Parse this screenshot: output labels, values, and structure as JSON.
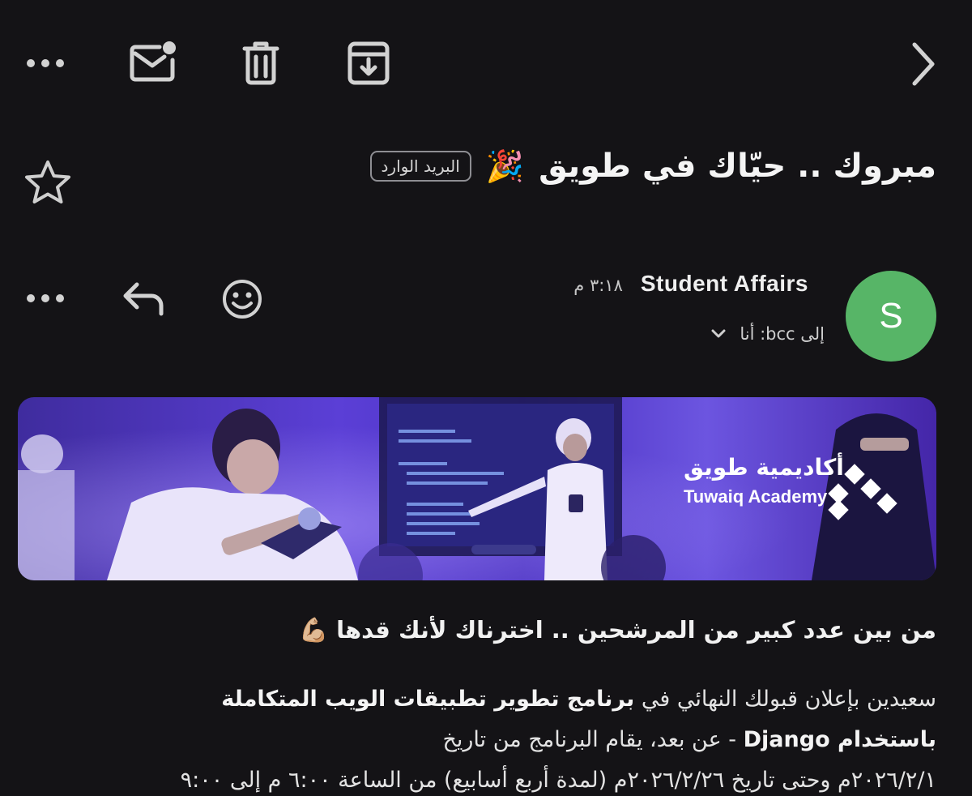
{
  "toolbar": {
    "icons": [
      "more-horizontal-icon",
      "mark-unread-icon",
      "trash-icon",
      "archive-icon",
      "chevron-right-icon"
    ]
  },
  "subject": {
    "text": "مبروك .. حيّاك في طويق",
    "emoji": "🎉",
    "label": "البريد الوارد"
  },
  "message": {
    "avatar_letter": "S",
    "avatar_color": "#57B567",
    "sender": "Student Affairs",
    "time": "٣:١٨ م",
    "recipient": "إلى bcc: أنا"
  },
  "banner": {
    "logo_ar": "أكاديمية طويق",
    "logo_en": "Tuwaiq Academy"
  },
  "body": {
    "headline": "من بين عدد كبير من المرشحين .. اخترناك لأنك قدها",
    "headline_emoji": "💪🏼",
    "line1_normal": "سعيدين بإعلان قبولك النهائي في",
    "line1_bold": "برنامج تطوير تطبيقات الويب المتكاملة",
    "line2_bold": "باستخدام  Django",
    "line2_normal": " - عن بعد، يقام البرنامج من تاريخ",
    "line3": "٢٠٢٦/٢/١م  وحتى تاريخ ٢٠٢٦/٢/٢٦م  (لمدة أربع أسابيع) من الساعة ٦:٠٠ م إلى ٩:٠٠"
  }
}
